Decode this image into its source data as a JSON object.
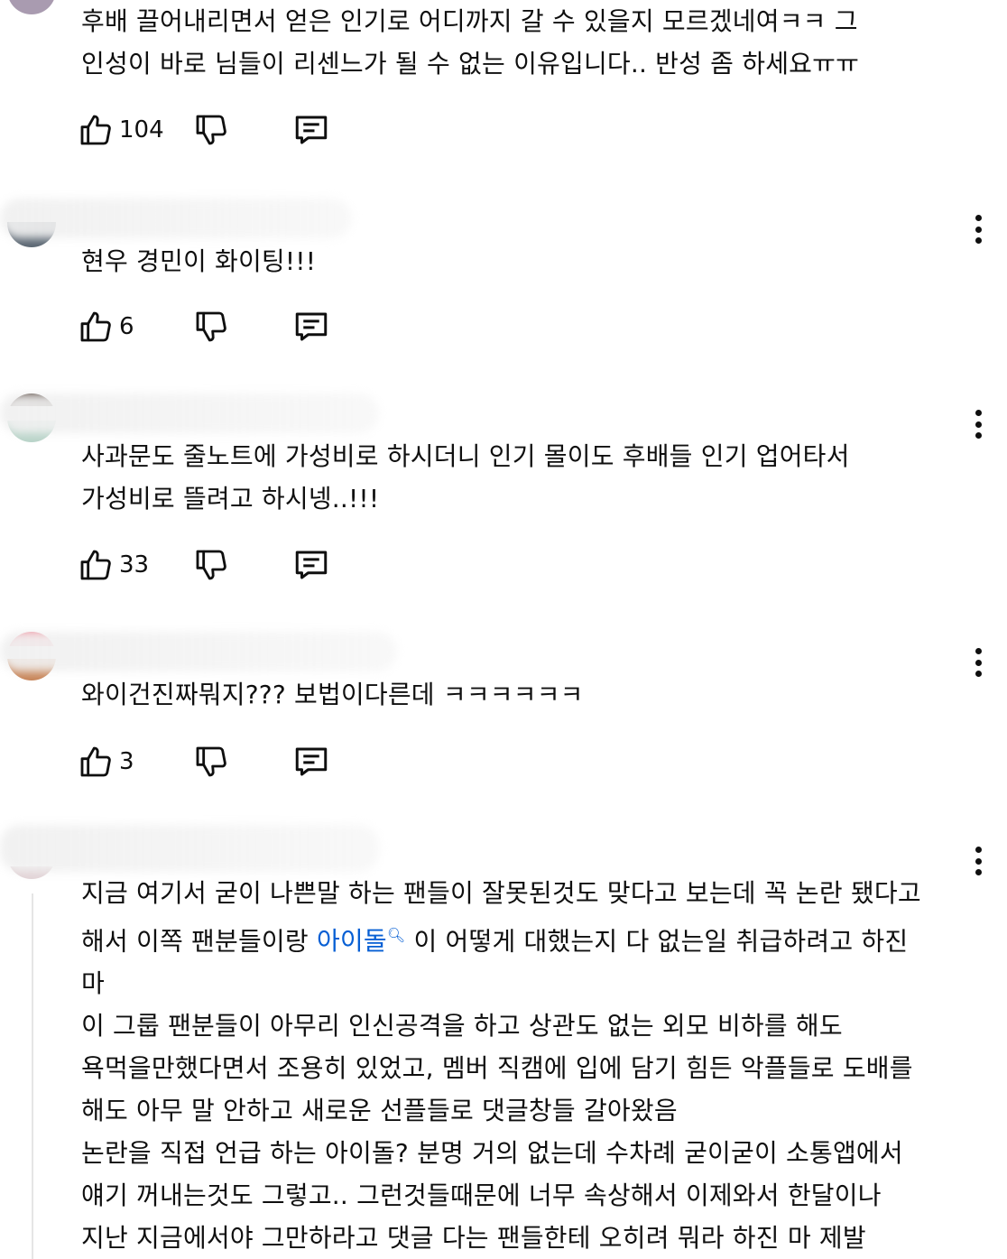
{
  "comments": [
    {
      "lines": [
        "후배 끌어내리면서 얻은 인기로 어디까지 갈 수 있을지 모르겠네여ㅋㅋ 그",
        "인성이 바로 님들이 리센느가 될 수 없는 이유입니다.. 반성 좀 하세요ㅠㅠ"
      ],
      "likes": "104"
    },
    {
      "lines": [
        "현우 경민이 화이팅!!!"
      ],
      "likes": "6"
    },
    {
      "lines": [
        "사과문도 줄노트에 가성비로 하시더니 인기 몰이도 후배들 인기 업어타서",
        "가성비로 뜰려고 하시넹..!!!"
      ],
      "likes": "33"
    },
    {
      "lines": [
        "와이건진짜뭐지??? 보법이다른데 ㅋㅋㅋㅋㅋㅋ"
      ],
      "likes": "3"
    },
    {
      "line1": "지금 여기서 굳이 나쁜말 하는 팬들이 잘못된것도 맞다고 보는데 꼭 논란 됐다고",
      "line2_before": "해서 이쪽 팬분들이랑 ",
      "line2_link": "아이돌",
      "line2_after": " 이 어떻게 대했는지 다 없는일 취급하려고 하진",
      "rest": [
        "마",
        "이 그룹 팬분들이 아무리 인신공격을 하고 상관도 없는 외모 비하를 해도",
        "욕먹을만했다면서 조용히 있었고, 멤버 직캠에 입에 담기 힘든 악플들로 도배를",
        "해도 아무 말 안하고 새로운 선플들로 댓글창들 갈아왔음",
        "논란을 직접 언급 하는 아이돌? 분명 거의 없는데 수차례 굳이굳이 소통앱에서",
        "얘기 꺼내는것도 그렇고.. 그런것들때문에 너무 속상해서 이제와서 한달이나",
        "지난 지금에서야 그만하라고 댓글 다는 팬들한테 오히려 뭐라 하진 마 제발"
      ]
    }
  ],
  "icons": {
    "like": "thumbs-up-icon",
    "dislike": "thumbs-down-icon",
    "reply": "reply-comment-icon",
    "more": "more-vertical-icon",
    "search": "search-icon"
  },
  "colors": {
    "link": "#065fd4",
    "text": "#0f0f0f"
  }
}
